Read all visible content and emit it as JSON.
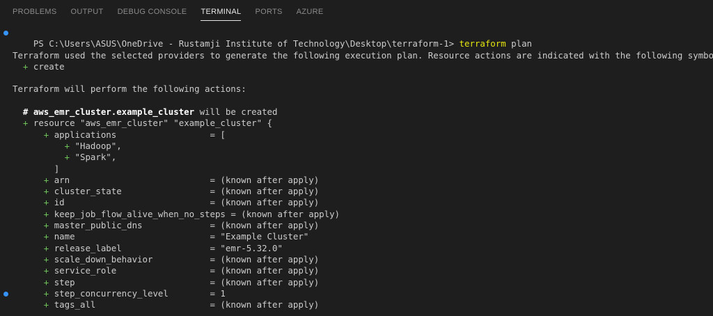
{
  "tabs": [
    "PROBLEMS",
    "OUTPUT",
    "DEBUG CONSOLE",
    "TERMINAL",
    "PORTS",
    "AZURE"
  ],
  "active_tab": "TERMINAL",
  "prompt": {
    "path": "PS C:\\Users\\ASUS\\OneDrive - Rustamji Institute of Technology\\Desktop\\terraform-1> ",
    "command": "terraform",
    "args": " plan"
  },
  "plan_intro": "Terraform used the selected providers to generate the following execution plan. Resource actions are indicated with the following symbols:",
  "symbol_legend": "create",
  "actions_heading": "Terraform will perform the following actions:",
  "resource_comment_prefix": "# ",
  "resource_address": "aws_emr_cluster.example_cluster",
  "resource_comment_suffix": " will be created",
  "resource_decl": "resource \"aws_emr_cluster\" \"example_cluster\" {",
  "applications": {
    "key": "applications                  = [",
    "items": [
      "\"Hadoop\",",
      "\"Spark\","
    ],
    "close": "]"
  },
  "attributes": [
    "arn                           = (known after apply)",
    "cluster_state                 = (known after apply)",
    "id                            = (known after apply)",
    "keep_job_flow_alive_when_no_steps = (known after apply)",
    "master_public_dns             = (known after apply)",
    "name                          = \"Example Cluster\"",
    "release_label                 = \"emr-5.32.0\"",
    "scale_down_behavior           = (known after apply)",
    "service_role                  = (known after apply)",
    "step                          = (known after apply)",
    "step_concurrency_level        = 1",
    "tags_all                      = (known after apply)"
  ],
  "plus_symbol": "+",
  "colors": {
    "background": "#1e1e1e",
    "plus": "#6fc25a",
    "command": "#e5e510",
    "dot": "#3794ff"
  }
}
